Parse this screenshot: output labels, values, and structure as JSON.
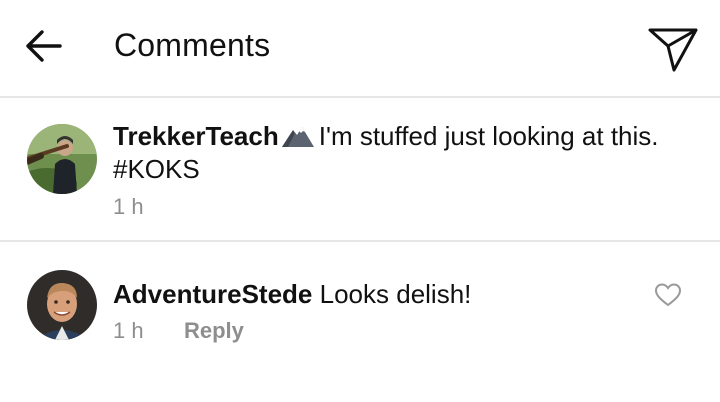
{
  "header": {
    "title": "Comments",
    "back_icon": "arrow-left-icon",
    "send_icon": "paper-plane-icon"
  },
  "comments": [
    {
      "username": "TrekkerTeach",
      "emoji_icon": "mountain-icon",
      "text": "I'm stuffed just looking at this. #KOKS",
      "time": "1 h"
    },
    {
      "username": "AdventureStede",
      "text": "Looks delish!",
      "time": "1 h",
      "reply_label": "Reply",
      "like_icon": "heart-outline-icon"
    }
  ],
  "colors": {
    "text": "#111111",
    "meta": "#8e8e8e",
    "divider": "#e6e6e6"
  }
}
